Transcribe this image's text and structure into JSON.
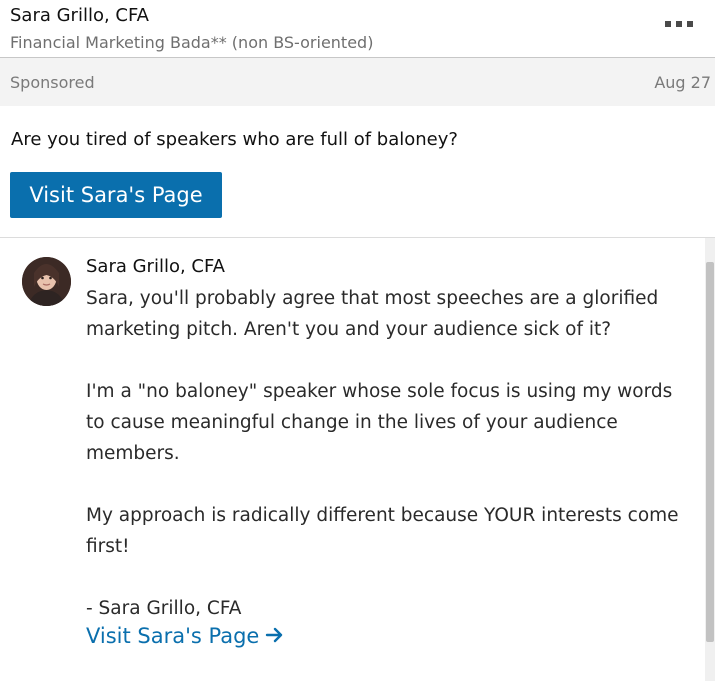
{
  "header": {
    "sender_name": "Sara Grillo, CFA",
    "sender_headline": "Financial Marketing Bada** (non BS-oriented)",
    "more_icon": "more-horizontal-icon"
  },
  "sponsor_bar": {
    "label": "Sponsored",
    "date": "Aug 27"
  },
  "ad": {
    "question": "Are you tired of speakers who are full of baloney?",
    "cta_label": "Visit Sara's Page"
  },
  "message": {
    "sender": "Sara Grillo, CFA",
    "paragraphs": [
      "Sara, you'll probably agree that most speeches are a glorified marketing pitch. Aren't you and your audience sick of it?",
      "I'm a \"no baloney\" speaker whose sole focus is using my words to cause meaningful change in the lives of your audience members.",
      "My approach is radically different because YOUR interests come first!",
      "- Sara Grillo, CFA"
    ],
    "link_label": "Visit Sara's Page",
    "link_icon": "arrow-right-icon"
  },
  "colors": {
    "accent": "#0a6fad",
    "sponsor_bg": "#f3f3f3",
    "muted_text": "#7a7a7a"
  }
}
